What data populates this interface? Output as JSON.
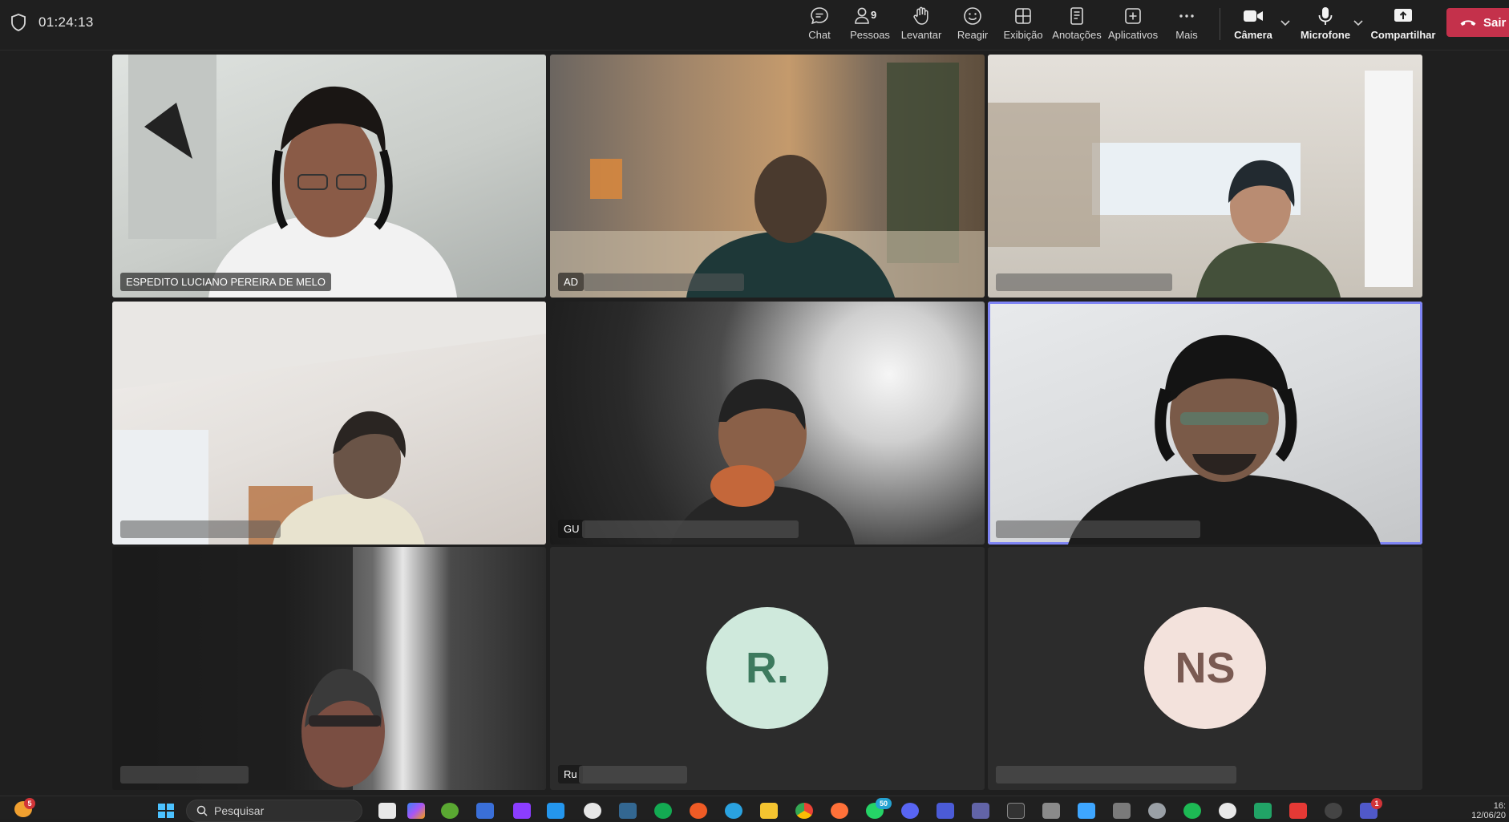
{
  "meeting": {
    "timer": "01:24:13"
  },
  "toolbar": {
    "chat": "Chat",
    "people": "Pessoas",
    "people_count": "9",
    "raise_hand": "Levantar",
    "react": "Reagir",
    "view": "Exibição",
    "notes": "Anotações",
    "apps": "Aplicativos",
    "more": "Mais",
    "camera": "Câmera",
    "mic": "Microfone",
    "share": "Compartilhar",
    "leave": "Sair",
    "leave_color": "#c4314b"
  },
  "participants": [
    {
      "name": "ESPEDITO LUCIANO PEREIRA DE MELO",
      "visible_initials": "",
      "name_partial": ""
    },
    {
      "name_partial": "AD"
    },
    {
      "name_partial": ""
    },
    {
      "name_partial": ""
    },
    {
      "name_partial": "GU"
    },
    {
      "name_partial": "",
      "active_speaker": true
    },
    {
      "name_partial": ""
    },
    {
      "name_partial": "Ru",
      "avatar": "R.",
      "avatar_color": "#cfe9dc",
      "avatar_text_color": "#3d7a5e"
    },
    {
      "name_partial": "",
      "avatar": "NS",
      "avatar_color": "#f3e2dc",
      "avatar_text_color": "#7a5a52"
    }
  ],
  "taskbar": {
    "search_placeholder": "Pesquisar",
    "weather_badge": "5",
    "whatsapp_badge": "50",
    "teams_badge": "1",
    "clock_time": "16:",
    "clock_date": "12/06/20"
  }
}
